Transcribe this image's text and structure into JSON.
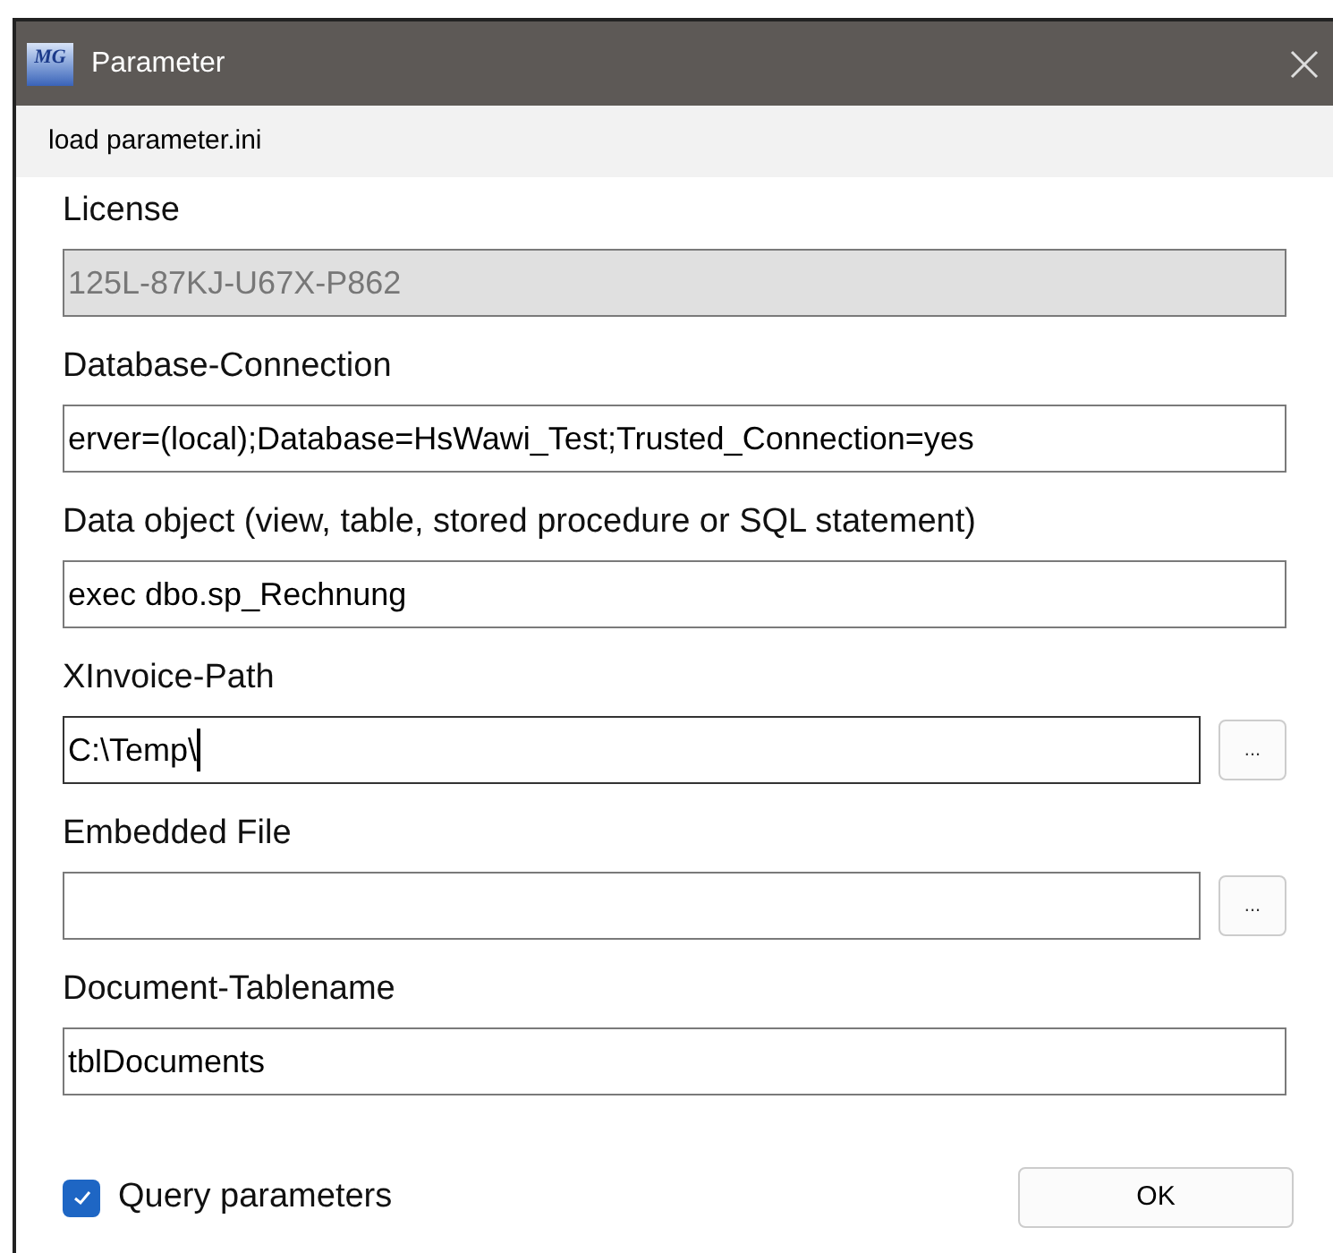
{
  "window": {
    "title": "Parameter",
    "icon_text": "MG"
  },
  "menu": [
    "load parameter.ini"
  ],
  "fields": [
    {
      "label": "License",
      "value": "125L-87KJ-U67X-P862",
      "disabled": true,
      "focused": false
    },
    {
      "label": "Database-Connection",
      "value": "erver=(local);Database=HsWawi_Test;Trusted_Connection=yes",
      "disabled": false,
      "focused": false
    },
    {
      "label": "Data object (view, table, stored procedure or SQL statement)",
      "value": "exec dbo.sp_Rechnung",
      "disabled": false,
      "focused": false
    },
    {
      "label": "XInvoice-Path",
      "value": "C:\\Temp\\",
      "disabled": false,
      "browse": "...",
      "focused": true
    },
    {
      "label": "Embedded File",
      "disabled": false,
      "browse": "...",
      "focused": false
    },
    {
      "label": "Document-Tablename",
      "value": "tblDocuments",
      "disabled": false,
      "focused": false
    }
  ],
  "query_parameters": {
    "label": "Query parameters",
    "checked": true
  },
  "ok_button": "OK"
}
